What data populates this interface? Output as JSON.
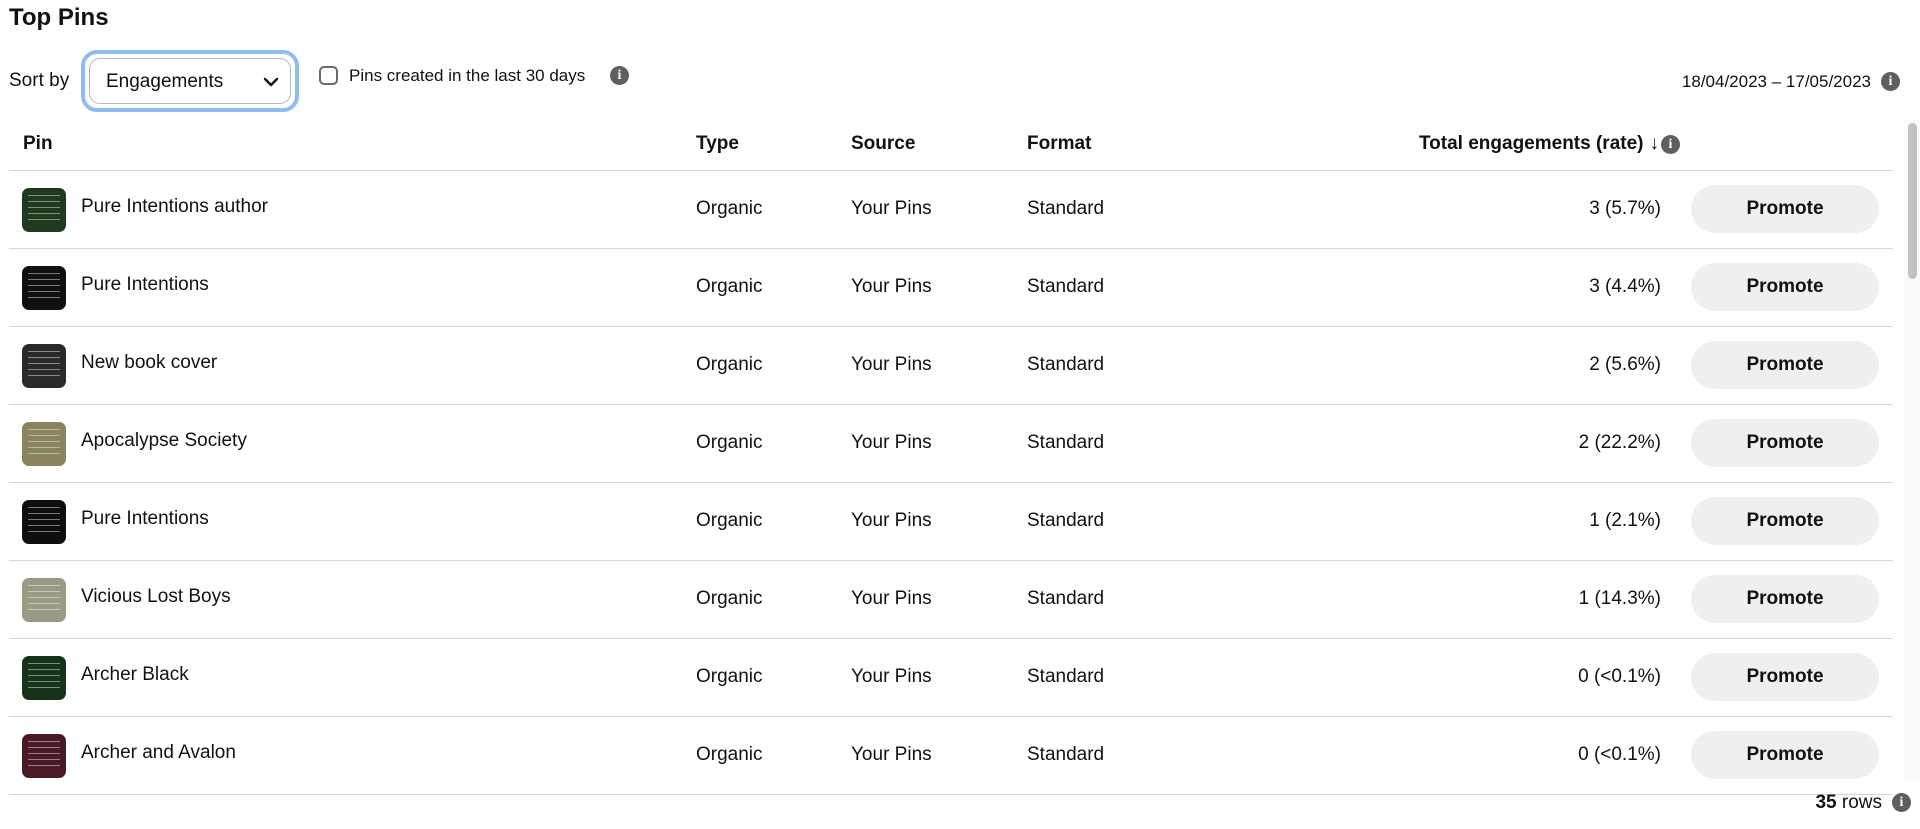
{
  "page": {
    "title": "Top Pins"
  },
  "controls": {
    "sort_label": "Sort by",
    "sort_value": "Engagements",
    "checkbox_label": "Pins created in the last 30 days",
    "checkbox_checked": false,
    "date_range": "18/04/2023 – 17/05/2023"
  },
  "table": {
    "headers": {
      "pin": "Pin",
      "type": "Type",
      "source": "Source",
      "format": "Format",
      "engagements": "Total engagements (rate)",
      "sort_arrow": "↓"
    },
    "promote_label": "Promote",
    "rows": [
      {
        "title": "Pure Intentions author",
        "type": "Organic",
        "source": "Your Pins",
        "format": "Standard",
        "engagements": "3 (5.7%)",
        "thumb_color": "#1f3a1f"
      },
      {
        "title": "Pure Intentions",
        "type": "Organic",
        "source": "Your Pins",
        "format": "Standard",
        "engagements": "3 (4.4%)",
        "thumb_color": "#111111"
      },
      {
        "title": "New book cover",
        "type": "Organic",
        "source": "Your Pins",
        "format": "Standard",
        "engagements": "2 (5.6%)",
        "thumb_color": "#2a2a2a"
      },
      {
        "title": "Apocalypse Society",
        "type": "Organic",
        "source": "Your Pins",
        "format": "Standard",
        "engagements": "2 (22.2%)",
        "thumb_color": "#8a8461"
      },
      {
        "title": "Pure Intentions",
        "type": "Organic",
        "source": "Your Pins",
        "format": "Standard",
        "engagements": "1 (2.1%)",
        "thumb_color": "#0e0e0e"
      },
      {
        "title": "Vicious Lost Boys",
        "type": "Organic",
        "source": "Your Pins",
        "format": "Standard",
        "engagements": "1 (14.3%)",
        "thumb_color": "#9c9a84"
      },
      {
        "title": "Archer Black",
        "type": "Organic",
        "source": "Your Pins",
        "format": "Standard",
        "engagements": "0 (<0.1%)",
        "thumb_color": "#16331a"
      },
      {
        "title": "Archer and Avalon",
        "type": "Organic",
        "source": "Your Pins",
        "format": "Standard",
        "engagements": "0 (<0.1%)",
        "thumb_color": "#4a1b25"
      }
    ]
  },
  "footer": {
    "row_count": "35",
    "rows_label": "rows"
  },
  "colors": {
    "focus_ring": "#8fbdf2",
    "promote_bg": "#efefef",
    "divider": "#d6d6d6",
    "info_icon": "#5f5f5f"
  },
  "icons": {
    "sort_dropdown": "chevron-down-icon",
    "info": "info-icon",
    "sort_direction": "arrow-down-icon"
  }
}
